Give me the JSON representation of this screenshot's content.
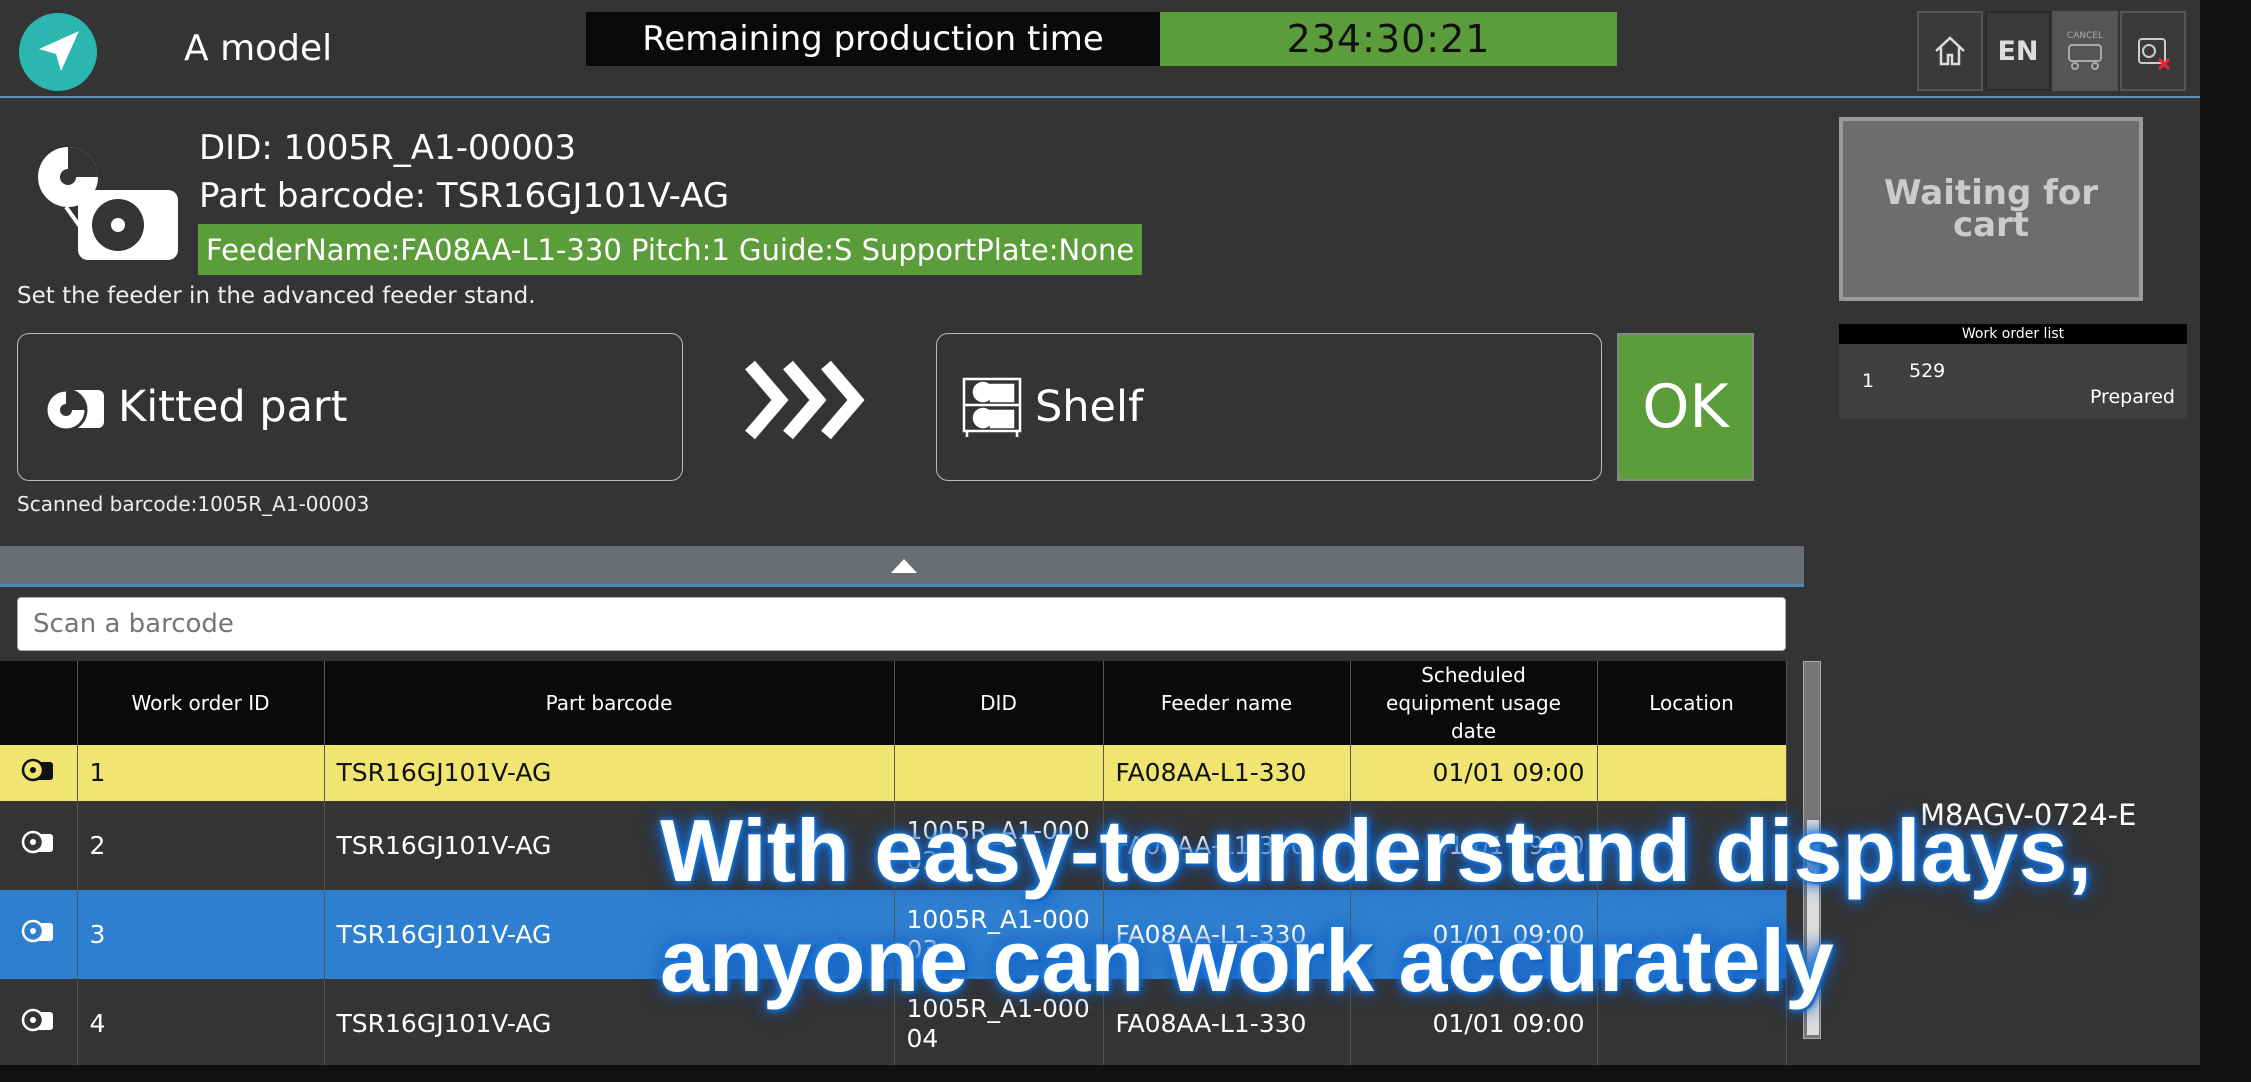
{
  "header": {
    "model_name": "A model",
    "remaining_label": "Remaining production time",
    "remaining_value": "234:30:21",
    "buttons": {
      "home": "home-icon",
      "language": "EN",
      "cancel_label": "CANCEL",
      "feeder_cancel": "feeder-cancel-icon"
    }
  },
  "part": {
    "did": "DID: 1005R_A1-00003",
    "barcode": "Part barcode: TSR16GJ101V-AG",
    "feeder_info": "FeederName:FA08AA-L1-330 Pitch:1 Guide:S SupportPlate:None",
    "instruction": "Set the feeder in the advanced feeder stand.",
    "source_label": "Kitted part",
    "destination_label": "Shelf",
    "ok_label": "OK",
    "scanned": "Scanned barcode:1005R_A1-00003"
  },
  "right_panel": {
    "waiting_label": "Waiting for cart",
    "work_order_list_title": "Work order list",
    "work_orders": [
      {
        "index": "1",
        "id": "529",
        "status": "Prepared"
      }
    ]
  },
  "search": {
    "placeholder": "Scan a barcode"
  },
  "table": {
    "headers": [
      "Work order ID",
      "Part barcode",
      "DID",
      "Feeder name",
      "Scheduled equipment usage date",
      "Location"
    ],
    "rows": [
      {
        "work_order_id": "1",
        "part_barcode": "TSR16GJ101V-AG",
        "did": "",
        "feeder_name": "FA08AA-L1-330",
        "date": "01/01 09:00",
        "location": "",
        "style": "yellow"
      },
      {
        "work_order_id": "2",
        "part_barcode": "TSR16GJ101V-AG",
        "did": "1005R_A1-00002",
        "feeder_name": "FA08AA-L1-330",
        "date": "01/01 09:00",
        "location": "M8AGV-0724-E",
        "style": "dark"
      },
      {
        "work_order_id": "3",
        "part_barcode": "TSR16GJ101V-AG",
        "did": "1005R_A1-00003",
        "feeder_name": "FA08AA-L1-330",
        "date": "01/01 09:00",
        "location": "",
        "style": "blue"
      },
      {
        "work_order_id": "4",
        "part_barcode": "TSR16GJ101V-AG",
        "did": "1005R_A1-00004",
        "feeder_name": "FA08AA-L1-330",
        "date": "01/01 09:00",
        "location": "",
        "style": "dark"
      }
    ]
  },
  "caption": {
    "line1": "With easy-to-understand displays,",
    "line2": "anyone can work accurately"
  },
  "colors": {
    "accent_green": "#5c9d3b",
    "highlight_yellow": "#f1e571",
    "selected_blue": "#2f7fd0",
    "background": "#343434"
  }
}
